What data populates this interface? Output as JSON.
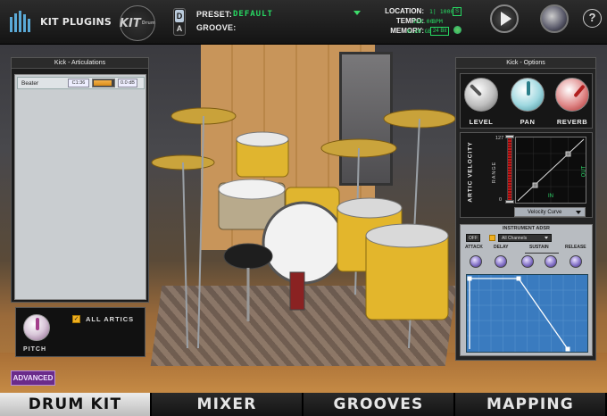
{
  "header": {
    "brand": "KIT PLUGINS",
    "kit_badge": "KIT",
    "kit_badge_sub": "Drum",
    "ab_top": "D",
    "ab_bottom": "A",
    "preset_label": "PRESET:",
    "preset_value": "DEFAULT",
    "groove_label": "GROOVE:",
    "location_label": "LOCATION:",
    "location_value": "1| 1000",
    "location_s": "S",
    "tempo_label": "TEMPO:",
    "tempo_value": "120.00",
    "tempo_unit": "BPM",
    "memory_label": "MEMORY:",
    "memory_value": "6.10 GB",
    "memory_bits": "24 Bit",
    "help": "?"
  },
  "left_panel": {
    "title": "Kick - Articulations",
    "articulations": [
      {
        "name": "Beater",
        "note": "C1:36",
        "level": 0.85,
        "db": "0.0 dB"
      }
    ],
    "pitch_label": "PITCH",
    "all_artics_label": "ALL ARTICS",
    "all_artics_checked": true
  },
  "right_panel": {
    "title": "Kick - Options",
    "knobs": [
      "LEVEL",
      "PAN",
      "REVERB"
    ],
    "velocity_label": "ARTIC VELOCITY",
    "range_label": "RANGE",
    "range_max": "127",
    "range_min": "0",
    "in_label": "IN",
    "out_label": "OUT",
    "velocity_curve": "Velocity Curve",
    "adsr_title": "INSTRUMENT ADSR",
    "adsr_off": "OFF",
    "adsr_channels": "All Channels",
    "adsr_labels": [
      "ATTACK",
      "DELAY",
      "SUSTAIN",
      "RELEASE"
    ]
  },
  "advanced_button": "ADVANCED",
  "tabs": [
    "DRUM KIT",
    "MIXER",
    "GROOVES",
    "MAPPING"
  ],
  "active_tab": "DRUM KIT",
  "colors": {
    "accent_green": "#27d862",
    "orange": "#f0b020",
    "purple": "#6a2b8a"
  }
}
